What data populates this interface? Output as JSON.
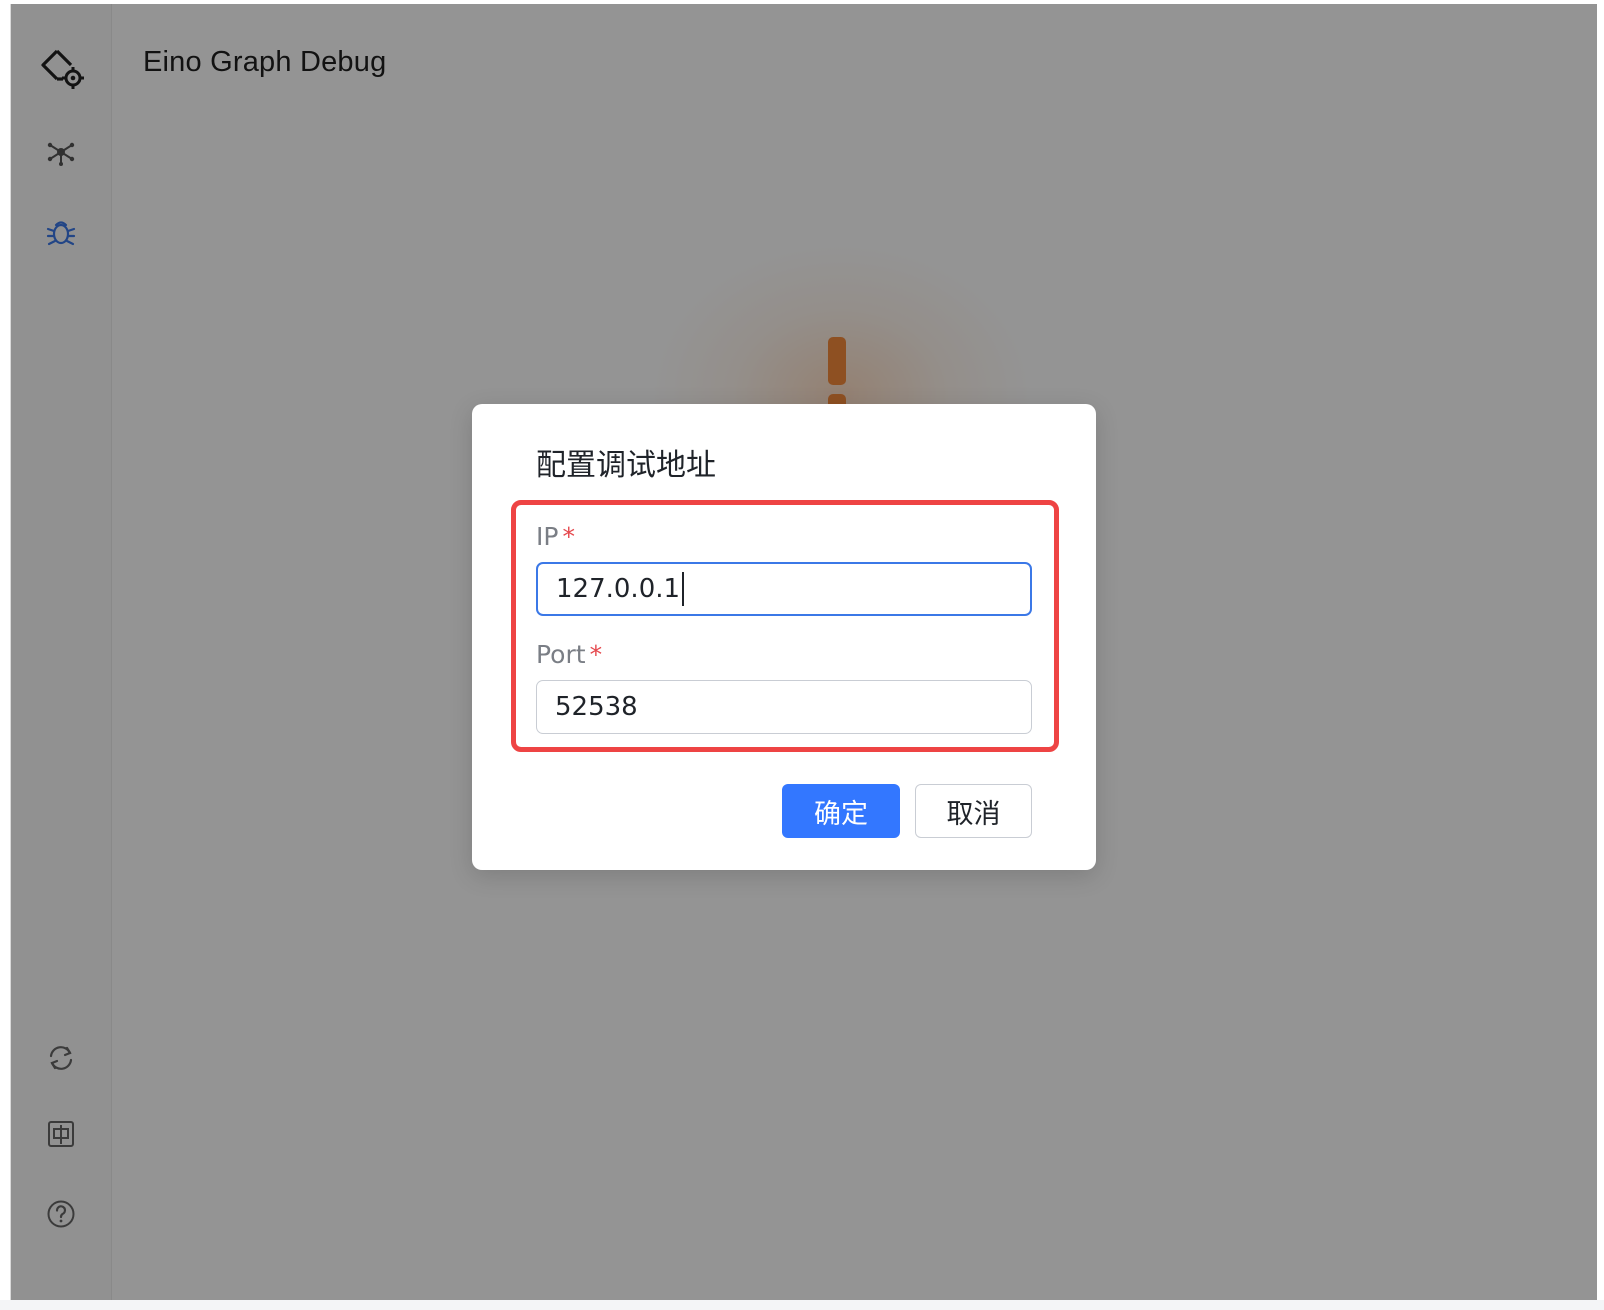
{
  "app": {
    "title": "Eino Graph Debug",
    "logo_icon": "debug-logo-icon"
  },
  "sidebar": {
    "items": [
      {
        "name": "graph",
        "icon": "graph-nodes-icon",
        "active": false
      },
      {
        "name": "debug",
        "icon": "bug-icon",
        "active": true
      }
    ],
    "bottom_items": [
      {
        "name": "refresh",
        "icon": "sync-icon"
      },
      {
        "name": "language",
        "icon": "language-zh-icon",
        "glyph": "中"
      },
      {
        "name": "help",
        "icon": "help-circle-icon",
        "glyph": "?"
      }
    ]
  },
  "modal": {
    "title": "配置调试地址",
    "fields": {
      "ip": {
        "label": "IP",
        "required_mark": "*",
        "value": "127.0.0.1"
      },
      "port": {
        "label": "Port",
        "required_mark": "*",
        "value": "52538"
      }
    },
    "buttons": {
      "ok": "确定",
      "cancel": "取消"
    }
  },
  "colors": {
    "primary": "#3377ff",
    "accent_active_icon": "#3b78e7",
    "required": "#e5484d",
    "highlight_box": "#ee4444",
    "warning": "#f58a3c"
  }
}
